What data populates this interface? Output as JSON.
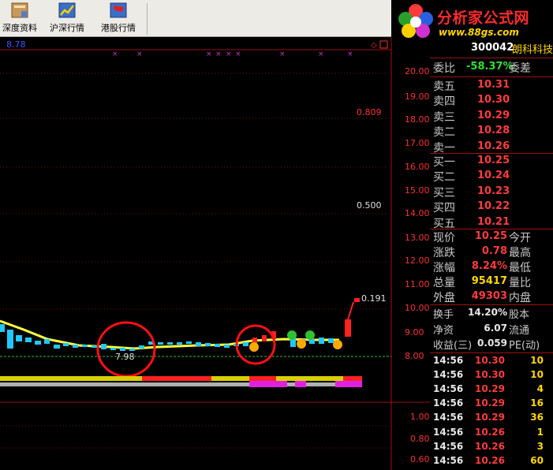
{
  "toolbar": {
    "buttons": [
      {
        "label": "深度资料",
        "icon": "book-icon"
      },
      {
        "label": "沪深行情",
        "icon": "chart-icon"
      },
      {
        "label": "港股行情",
        "icon": "flag-icon"
      }
    ]
  },
  "logo": {
    "title": "分析家公式网",
    "url_text": "www.88gs.com"
  },
  "chart": {
    "top_label": "8.78",
    "annotations": [
      "0.809",
      "0.500",
      "0.191",
      "7.98"
    ],
    "right_axis_main": [
      "20.00",
      "19.00",
      "18.00",
      "17.00",
      "16.00",
      "15.00",
      "14.00",
      "13.00",
      "12.00",
      "11.00",
      "10.00",
      "9.00",
      "8.00"
    ],
    "right_axis_sub": [
      "1.00",
      "0.80",
      "0.60"
    ]
  },
  "panel": {
    "code": "300042",
    "name": "朗科科技",
    "weibi_label": "委比",
    "weibi_value": "-58.37%",
    "weicha_label": "委差",
    "asks": [
      {
        "label": "卖五",
        "price": "10.31"
      },
      {
        "label": "卖四",
        "price": "10.30"
      },
      {
        "label": "卖三",
        "price": "10.29"
      },
      {
        "label": "卖二",
        "price": "10.28"
      },
      {
        "label": "卖一",
        "price": "10.26"
      }
    ],
    "bids": [
      {
        "label": "买一",
        "price": "10.25"
      },
      {
        "label": "买二",
        "price": "10.24"
      },
      {
        "label": "买三",
        "price": "10.23"
      },
      {
        "label": "买四",
        "price": "10.22"
      },
      {
        "label": "买五",
        "price": "10.21"
      }
    ],
    "stats": [
      {
        "label": "现价",
        "value": "10.25",
        "label2": "今开",
        "color": "#ff3b3b"
      },
      {
        "label": "涨跌",
        "value": "0.78",
        "label2": "最高",
        "color": "#ff3b3b"
      },
      {
        "label": "涨幅",
        "value": "8.24%",
        "label2": "最低",
        "color": "#ff3b3b"
      },
      {
        "label": "总量",
        "value": "95417",
        "label2": "量比",
        "color": "#ffd800"
      },
      {
        "label": "外盘",
        "value": "49303",
        "label2": "内盘",
        "color": "#ff3b3b"
      }
    ],
    "fin": [
      {
        "label": "换手",
        "value": "14.20%",
        "label2": "股本"
      },
      {
        "label": "净资",
        "value": "6.07",
        "label2": "流通"
      },
      {
        "label": "收益(三)",
        "value": "0.059",
        "label2": "PE(动)"
      }
    ],
    "ticks": [
      {
        "time": "14:56",
        "price": "10.30",
        "vol": "10"
      },
      {
        "time": "14:56",
        "price": "10.30",
        "vol": "10"
      },
      {
        "time": "14:56",
        "price": "10.29",
        "vol": "4"
      },
      {
        "time": "14:56",
        "price": "10.29",
        "vol": "16"
      },
      {
        "time": "14:56",
        "price": "10.29",
        "vol": "36"
      },
      {
        "time": "14:56",
        "price": "10.26",
        "vol": "1"
      },
      {
        "time": "14:56",
        "price": "10.26",
        "vol": "3"
      },
      {
        "time": "14:56",
        "price": "10.26",
        "vol": "60"
      }
    ]
  }
}
